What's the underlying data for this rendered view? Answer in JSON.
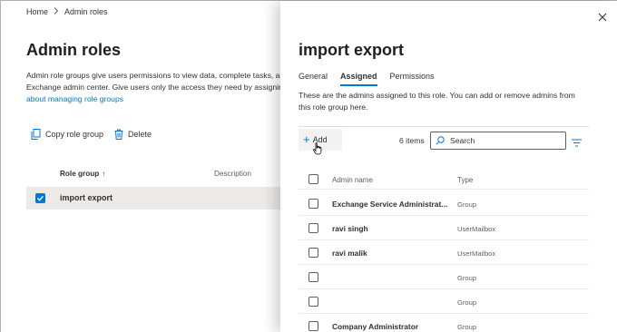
{
  "breadcrumb": {
    "home": "Home",
    "separator": ">",
    "current": "Admin roles"
  },
  "page": {
    "title": "Admin roles",
    "description_line1": "Admin role groups give users permissions to view data, complete tasks, a",
    "description_line2": "Exchange admin center. Give users only the access they need by assignin",
    "description_link": "about managing role groups"
  },
  "commands": {
    "copy": "Copy role group",
    "delete": "Delete"
  },
  "list": {
    "col_name": "Role group",
    "sort_arrow": "↑",
    "col_desc": "Description",
    "selected_row": "import export"
  },
  "panel": {
    "title": "import export",
    "tabs": [
      "General",
      "Assigned",
      "Permissions"
    ],
    "active_tab": "Assigned",
    "description": "These are the admins assigned to this role. You can add or remove admins from this role group here.",
    "add_label": "Add",
    "items_count": "6 items",
    "search_placeholder": "Search",
    "table": {
      "headers": {
        "name": "Admin name",
        "type": "Type"
      },
      "rows": [
        {
          "name": "Exchange Service Administrat...",
          "type": "Group"
        },
        {
          "name": "ravi singh",
          "type": "UserMailbox"
        },
        {
          "name": "ravi malik",
          "type": "UserMailbox"
        },
        {
          "name": "",
          "type": "Group"
        },
        {
          "name": "",
          "type": "Group"
        },
        {
          "name": "Company Administrator",
          "type": "Group"
        }
      ]
    }
  },
  "colors": {
    "accent": "#0078d4",
    "text": "#323130",
    "row_selected": "#edebe9"
  },
  "icons": [
    "chevron-right-icon",
    "copy-icon",
    "trash-icon",
    "checkbox-checked-icon",
    "close-icon",
    "plus-icon",
    "hand-cursor-icon",
    "search-icon",
    "filter-icon"
  ]
}
